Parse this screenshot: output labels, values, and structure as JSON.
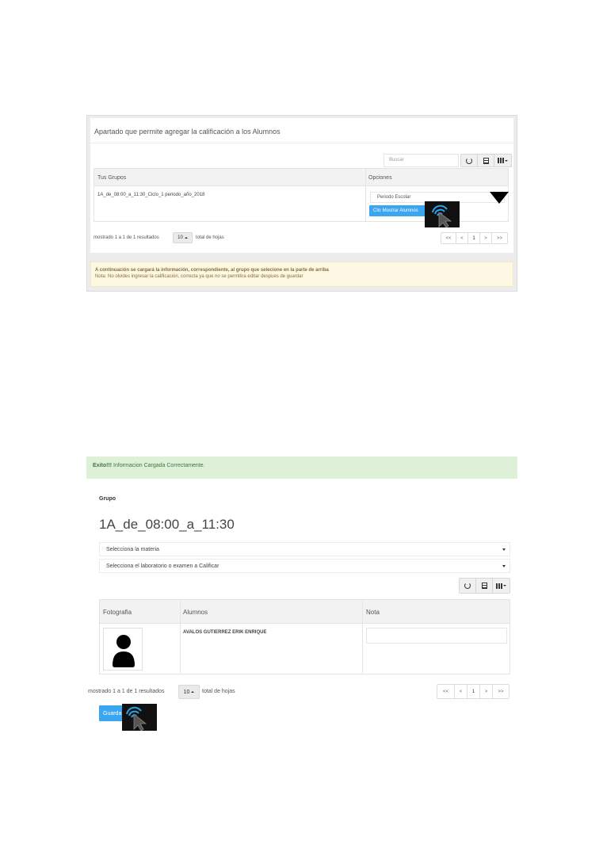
{
  "panel1": {
    "heading": "Apartado que permite agregar la calificación a los Alumnos",
    "search": {
      "placeholder": "Buscar"
    },
    "toolbar": {
      "icons": [
        "refresh-icon",
        "table-icon",
        "columns-icon"
      ]
    },
    "table": {
      "headers": [
        "Tus Grupos",
        "Opciones"
      ],
      "rows": [
        {
          "group": "1A_de_08:00_a_11:30_Ciclo_1 periodo_año_2018",
          "period_select": "Periodo Escolar",
          "button": "Clic Mostrar Alumnos"
        }
      ]
    },
    "pagination": {
      "shown": "mostrado 1 a 1 de 1 resultados",
      "page_size": "10",
      "total_label": "total de hojas",
      "pages": [
        "<<",
        "<",
        "1",
        ">",
        ">>"
      ]
    },
    "warning": {
      "line1": "A continuación se cargará la información, correspondiente, al grupo que selecione en la parte de arriba",
      "line2": "Nota: No olvides ingresar la calificación, correcta ya que no se permitira editar despues de guardar"
    }
  },
  "panel2": {
    "alert": {
      "strong": "Exito!!!",
      "text": " Informacion Cargada Correctamente."
    },
    "grupo_label": "Grupo",
    "grupo_title": "1A_de_08:00_a_11:30",
    "materia_select": "Selecciona la materia",
    "lab_select": "Selecciona el laboratorio o examen a Calificar",
    "toolbar": {
      "icons": [
        "refresh-icon",
        "table-icon",
        "columns-icon"
      ]
    },
    "table": {
      "headers": [
        "Fotografia",
        "Alumnos",
        "Nota"
      ],
      "rows": [
        {
          "photo": "avatar-icon",
          "student": "AVALOS GUTIERREZ ERIK ENRIQUE",
          "nota": ""
        }
      ]
    },
    "pagination": {
      "shown": "mostrado 1 a 1 de 1 resultados",
      "page_size": "10",
      "total_label": "total de hojas",
      "pages": [
        "<<",
        "<",
        "1",
        ">",
        ">>"
      ]
    },
    "save_button": "Guarda"
  },
  "colors": {
    "primary_button": "#3aa5f1",
    "success_bg": "#dff0d8",
    "warning_bg": "#fcf8e3"
  }
}
